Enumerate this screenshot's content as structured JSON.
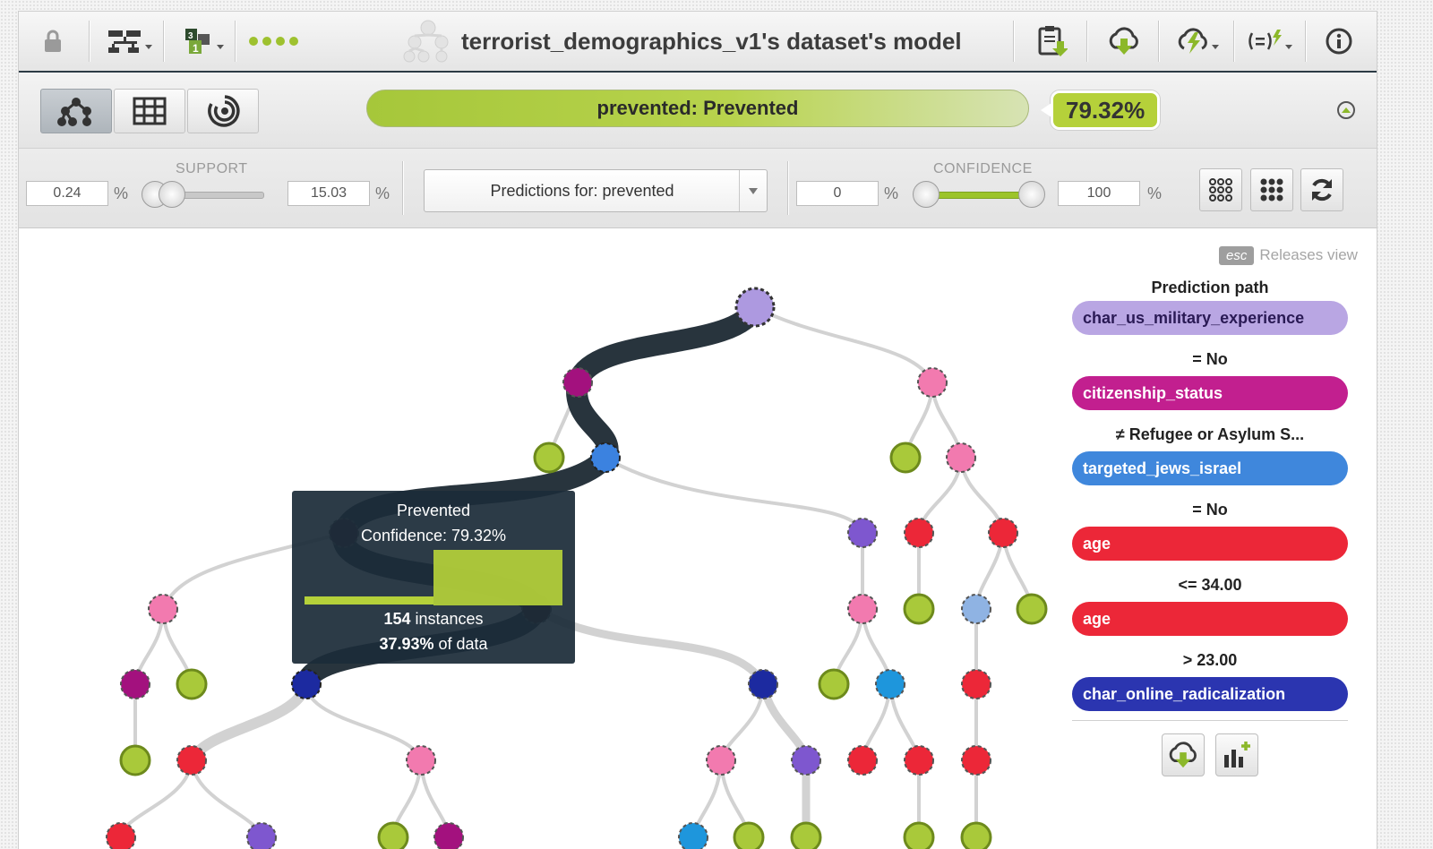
{
  "header": {
    "title": "terrorist_demographics_v1's dataset's model",
    "icons": [
      "lock-icon",
      "tree-icon",
      "numbered-blocks-icon",
      "dots-icon",
      "model-icon",
      "clipboard-download-icon",
      "cloud-download-icon",
      "lightning-cloud-icon",
      "formula-lightning-icon",
      "info-icon"
    ]
  },
  "prediction": {
    "label": "prevented: Prevented",
    "confidence": "79.32%",
    "bar_fill": 1.0
  },
  "filters": {
    "support_label": "SUPPORT",
    "support_min": "0.24",
    "support_max": "15.03",
    "percent": "%",
    "predictions_select": "Predictions for: prevented",
    "confidence_label": "CONFIDENCE",
    "confidence_min": "0",
    "confidence_max": "100"
  },
  "release": {
    "key": "esc",
    "text": "Releases view"
  },
  "path_panel": {
    "title": "Prediction path",
    "steps": [
      {
        "field": "char_us_military_experience",
        "bg": "#b9a6e3",
        "fg": "#2a1a55",
        "condition": "= No"
      },
      {
        "field": "citizenship_status",
        "bg": "#c21f8f",
        "fg": "#ffffff",
        "condition": "≠ Refugee or Asylum S..."
      },
      {
        "field": "targeted_jews_israel",
        "bg": "#3f87dc",
        "fg": "#ffffff",
        "condition": "= No"
      },
      {
        "field": "age",
        "bg": "#ec2738",
        "fg": "#ffffff",
        "condition": "<= 34.00"
      },
      {
        "field": "age",
        "bg": "#ec2738",
        "fg": "#ffffff",
        "condition": "> 23.00"
      },
      {
        "field": "char_online_radicalization",
        "bg": "#2b35b0",
        "fg": "#ffffff",
        "condition": ""
      }
    ]
  },
  "tooltip": {
    "class": "Prevented",
    "confidence": "Confidence: 79.32%",
    "instances_num": "154",
    "instances_text": " instances",
    "data_pct": "37.93%",
    "data_text": " of data"
  },
  "colors": {
    "green": "#a9c93a",
    "path": "#28343d",
    "lavender": "#ad99e0",
    "magenta": "#a3117e",
    "blue": "#3b82e0",
    "pink": "#f27aaf",
    "red": "#ec2738",
    "navy": "#1c2aa0",
    "purple": "#7e57cf",
    "cyan": "#1e96dc",
    "lightblue": "#8fb3e3"
  }
}
